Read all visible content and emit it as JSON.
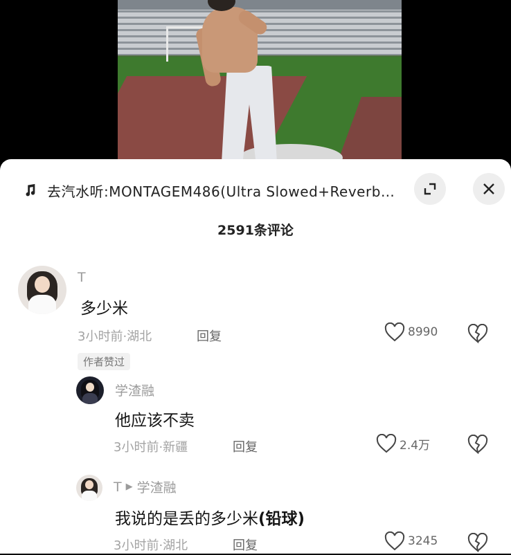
{
  "music": {
    "icon": "music-note-icon",
    "text": "去汽水听:MONTAGEM486(Ultra Slowed+Reverb…"
  },
  "header": {
    "comment_count": "2591条评论",
    "expand_icon": "expand-icon",
    "close_icon": "close-icon"
  },
  "comments": [
    {
      "username": "T",
      "content": "多少米",
      "meta": "3小时前·湖北",
      "reply_label": "回复",
      "likes": "8990",
      "tag": "作者赞过"
    },
    {
      "username": "学渣融",
      "content": "他应该不卖",
      "meta": "3小时前·新疆",
      "reply_label": "回复",
      "likes": "2.4万"
    },
    {
      "username": "T",
      "reply_to": "学渣融",
      "content": "我说的是丢的多少米",
      "content_suffix": "(铅球)",
      "meta": "3小时前·湖北",
      "reply_label": "回复",
      "likes": "3245"
    }
  ],
  "colors": {
    "sheet_bg": "#ffffff",
    "secondary_text": "#9b9b9b",
    "primary_text": "#151515"
  }
}
